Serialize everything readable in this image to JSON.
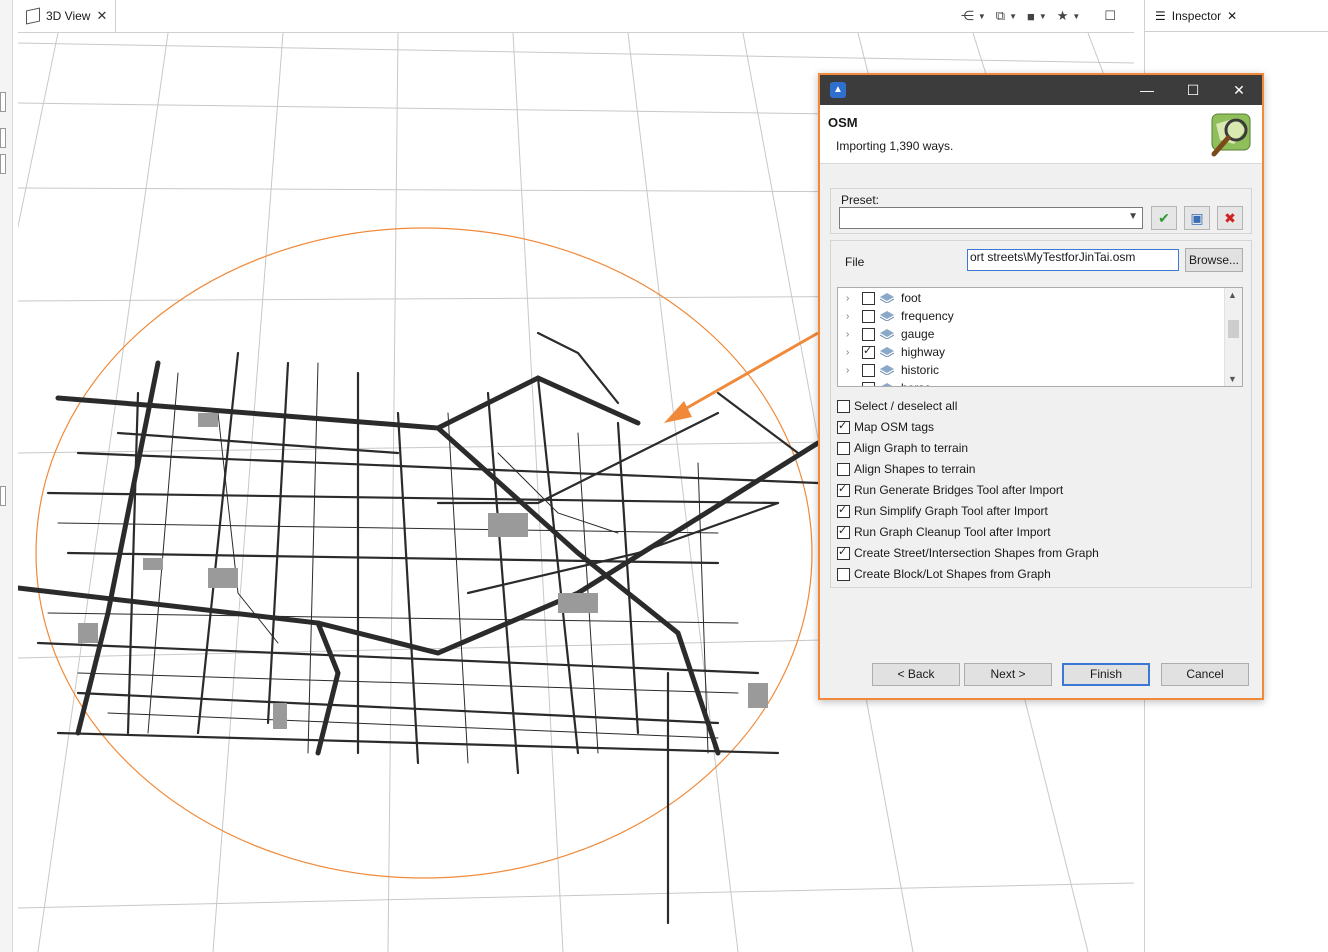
{
  "view_panel": {
    "tab_label": "3D View",
    "toolbar_icons": [
      "share-icon",
      "cube-icon",
      "camera-icon",
      "star-icon",
      "maximize-icon"
    ]
  },
  "inspector": {
    "tab_label": "Inspector"
  },
  "dialog": {
    "title": "OSM",
    "subtitle": "Importing 1,390 ways.",
    "preset": {
      "label": "Preset:",
      "value": ""
    },
    "file": {
      "label": "File",
      "value": "ort streets\\MyTestforJinTai.osm",
      "browse_label": "Browse..."
    },
    "tree_items": [
      {
        "label": "foot",
        "checked": false
      },
      {
        "label": "frequency",
        "checked": false
      },
      {
        "label": "gauge",
        "checked": false
      },
      {
        "label": "highway",
        "checked": true
      },
      {
        "label": "historic",
        "checked": false
      },
      {
        "label": "horse",
        "checked": false
      }
    ],
    "options": [
      {
        "label": "Select / deselect all",
        "checked": false
      },
      {
        "label": "Map OSM tags",
        "checked": true
      },
      {
        "label": "Align Graph to terrain",
        "checked": false
      },
      {
        "label": "Align Shapes to terrain",
        "checked": false
      },
      {
        "label": "Run Generate Bridges Tool after Import",
        "checked": true
      },
      {
        "label": "Run Simplify Graph Tool after Import",
        "checked": true
      },
      {
        "label": "Run Graph Cleanup Tool after Import",
        "checked": true
      },
      {
        "label": "Create Street/Intersection Shapes from Graph",
        "checked": true
      },
      {
        "label": "Create Block/Lot Shapes from Graph",
        "checked": false
      }
    ],
    "buttons": {
      "back": "< Back",
      "next": "Next >",
      "finish": "Finish",
      "cancel": "Cancel"
    }
  },
  "colors": {
    "accent_border": "#f08a3a",
    "titlebar": "#3c3c3c",
    "circle": "#f08a3a"
  }
}
